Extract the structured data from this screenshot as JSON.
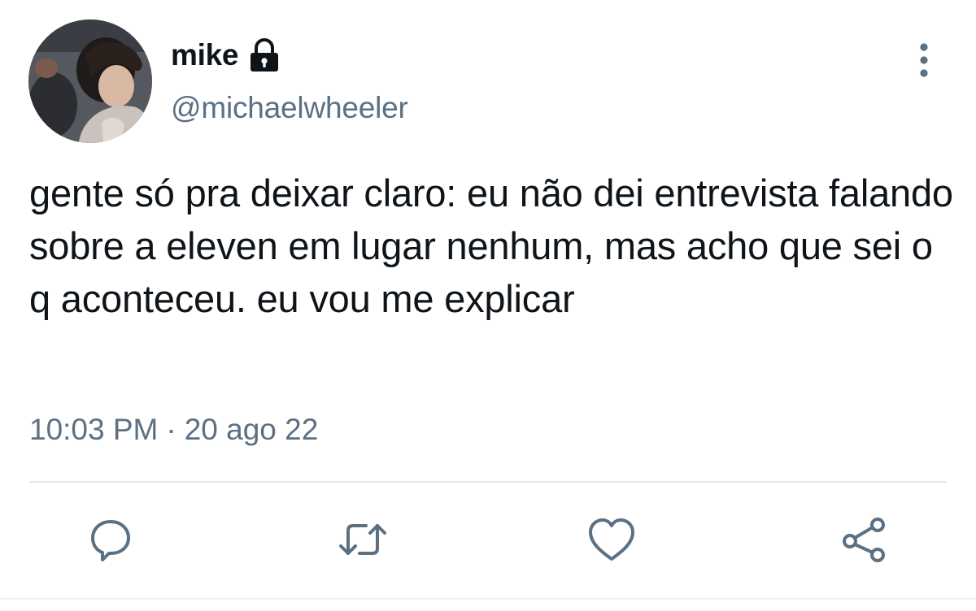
{
  "user": {
    "display_name": "mike",
    "handle": "@michaelwheeler",
    "protected_icon": "lock-icon",
    "avatar_icon": "profile-photo"
  },
  "tweet": {
    "text": "gente só pra deixar claro: eu não dei entrevista falando sobre a eleven em lugar nenhum, mas acho que sei o q aconteceu. eu vou me explicar",
    "time": "10:03 PM",
    "separator": "·",
    "date": "20 ago 22"
  },
  "menu": {
    "icon": "more-vertical-icon"
  },
  "actions": [
    {
      "name": "reply",
      "icon": "reply-icon"
    },
    {
      "name": "retweet",
      "icon": "retweet-icon"
    },
    {
      "name": "like",
      "icon": "heart-icon"
    },
    {
      "name": "share",
      "icon": "share-icon"
    }
  ],
  "colors": {
    "text_primary": "#0f1419",
    "text_secondary": "#5b7083",
    "icon_gray": "#5b7083",
    "divider": "#e1e6ea",
    "background": "#ffffff"
  }
}
